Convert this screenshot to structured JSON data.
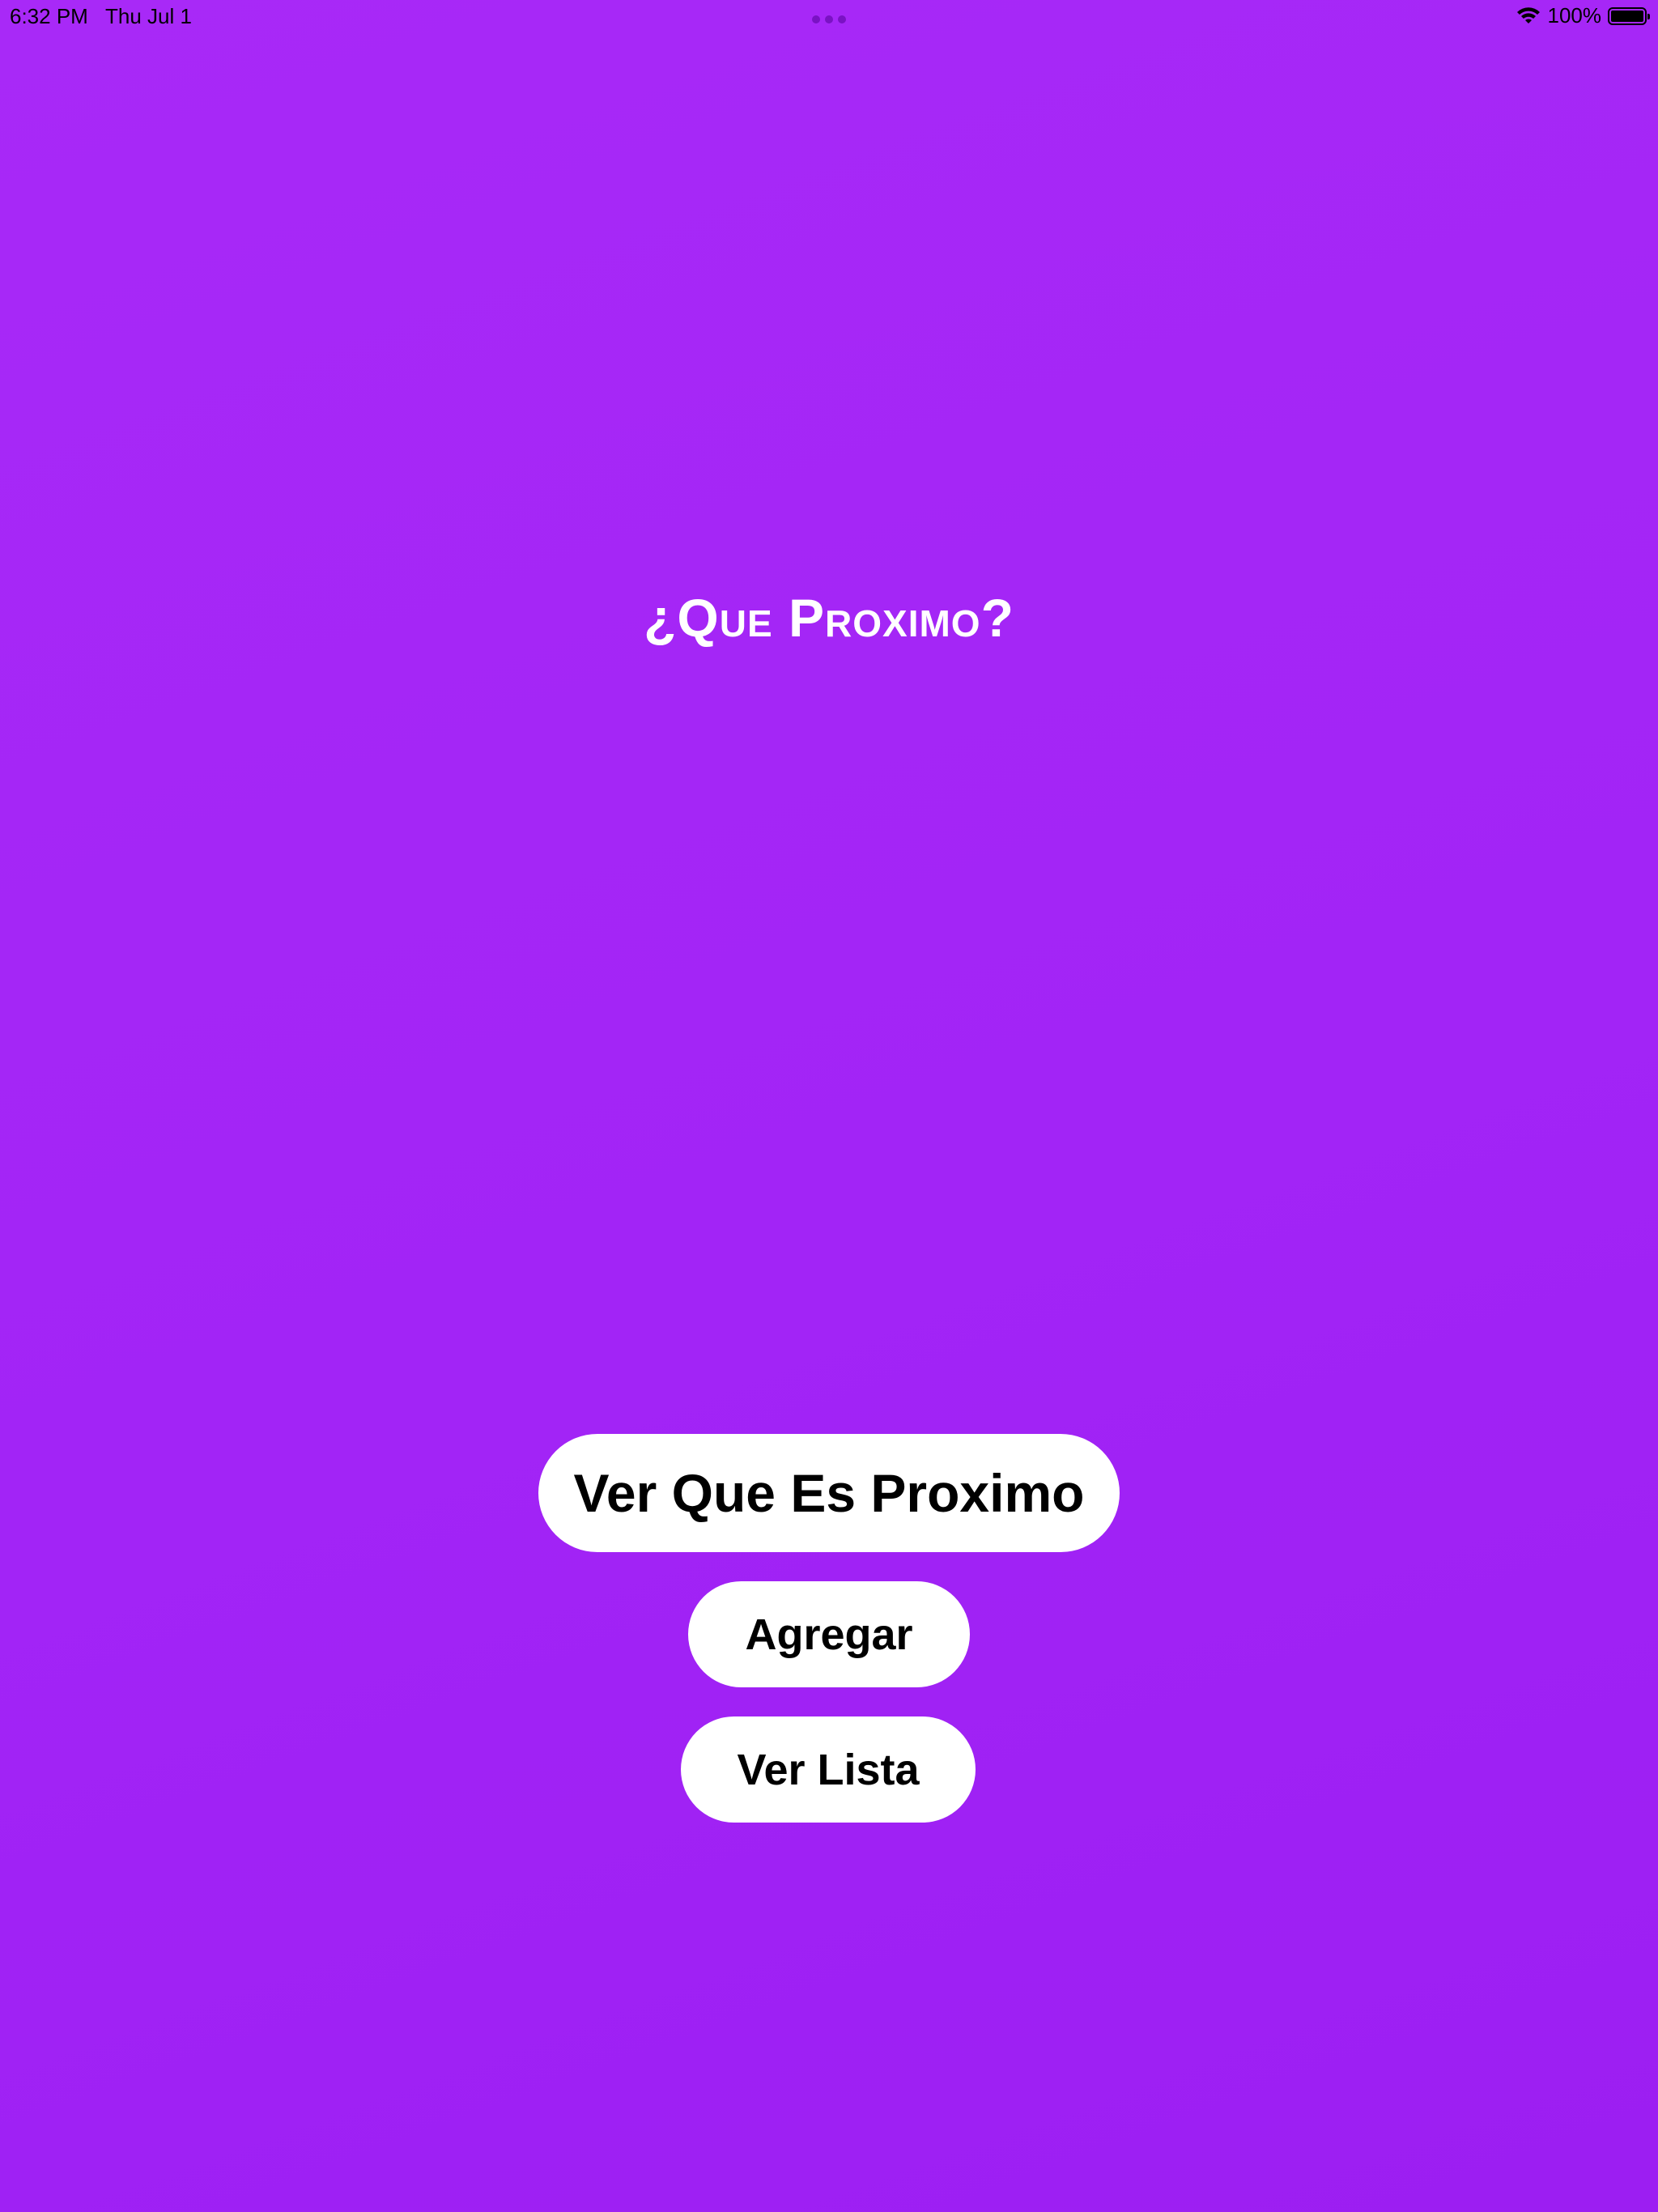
{
  "status_bar": {
    "time": "6:32 PM",
    "date": "Thu Jul 1",
    "battery_text": "100%",
    "battery_level": 1.0,
    "icons": [
      "wifi-icon",
      "battery-icon",
      "multitask-dots-icon"
    ]
  },
  "main": {
    "title": "¿Que Proximo?",
    "buttons": {
      "primary_label": "Ver Que Es Proximo",
      "add_label": "Agregar",
      "list_label": "Ver Lista"
    }
  },
  "colors": {
    "background": "#a524f6",
    "button_background": "#ffffff",
    "button_text": "#000000",
    "title_text": "#ffffff"
  }
}
